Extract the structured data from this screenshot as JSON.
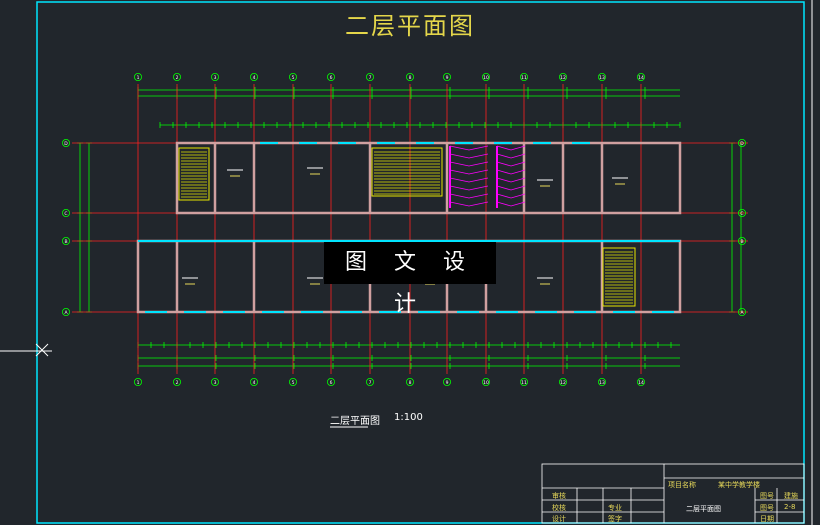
{
  "drawing": {
    "title": "二层平面图",
    "caption": "二层平面图",
    "scale": "1:100",
    "watermark": "图 文 设 计"
  },
  "title_block": {
    "project_label": "项目名称",
    "project_value": "某中学教学楼",
    "drawing_name": "二层平面图",
    "row_labels": [
      "审核",
      "校核",
      "设计"
    ],
    "mid_labels": [
      "专业",
      "签字"
    ],
    "right_labels": [
      "图号",
      "图号",
      "日期"
    ],
    "right_values": [
      "建施",
      "2-8",
      ""
    ]
  },
  "grid_axes": {
    "numbers": [
      "1",
      "2",
      "3",
      "4",
      "5",
      "6",
      "7",
      "8",
      "9",
      "10",
      "11",
      "12",
      "13",
      "14"
    ],
    "letters": [
      "D",
      "C",
      "B",
      "A"
    ]
  },
  "colors": {
    "background": "#21262c",
    "title": "#e4d64a",
    "frame": "#00e5ff",
    "grid_lines": "#ff2020",
    "dimension_lines": "#00ff00",
    "stairs": "#e6e600",
    "toilets": "#ff00ff"
  }
}
